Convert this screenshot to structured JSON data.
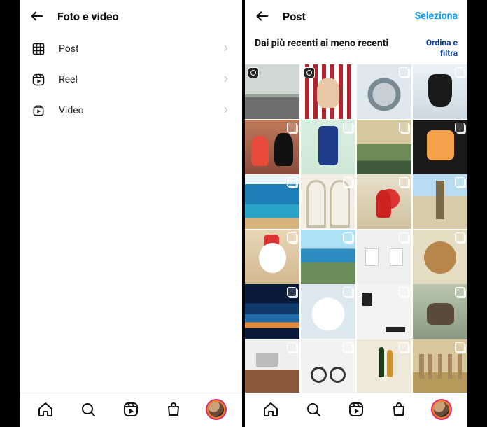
{
  "left": {
    "title": "Foto e video",
    "rows": [
      {
        "label": "Post"
      },
      {
        "label": "Reel"
      },
      {
        "label": "Video"
      }
    ]
  },
  "right": {
    "title": "Post",
    "action": "Seleziona",
    "subtitle": "Dai più recenti ai meno recenti",
    "sort": "Ordina e\nfiltra"
  }
}
